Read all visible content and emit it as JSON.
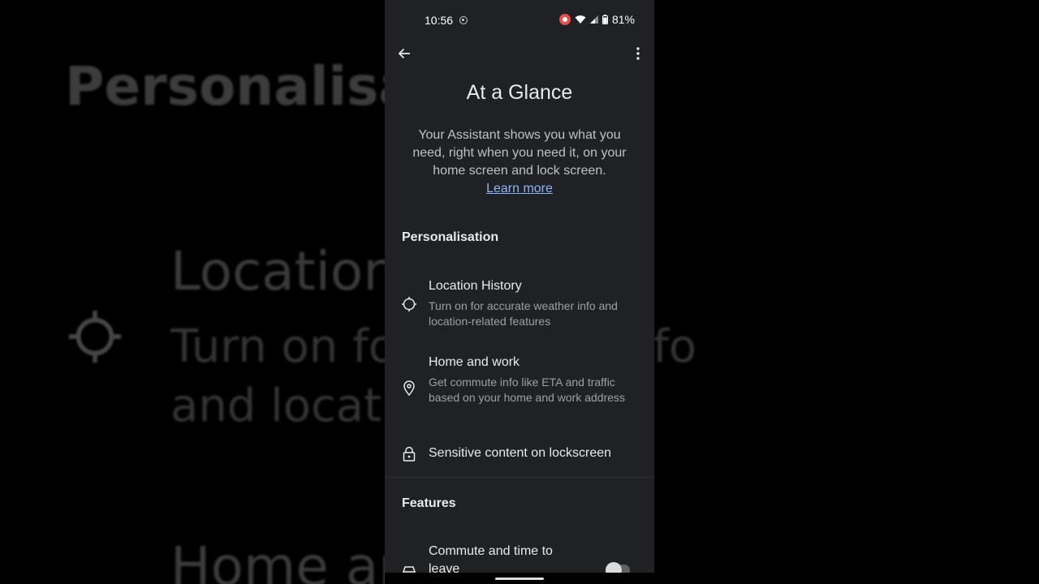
{
  "background": {
    "title": "Personalisat",
    "location_title": "Location",
    "location_desc_line1": "Turn on fo                         weather info",
    "location_desc_line2": "and locati                          eatures",
    "home_title": "Home an"
  },
  "status_bar": {
    "time": "10:56",
    "battery": "81%"
  },
  "header": {
    "title": "At a Glance",
    "description": "Your Assistant shows you what you need, right when you need it, on your home screen and lock screen.",
    "learn_more": "Learn more"
  },
  "sections": {
    "personalisation": "Personalisation",
    "features": "Features"
  },
  "items": {
    "location_history": {
      "title": "Location History",
      "subtitle": "Turn on for accurate weather info and location-related features",
      "icon": "location-target-icon"
    },
    "home_work": {
      "title": "Home and work",
      "subtitle": "Get commute info like ETA and traffic based on your home and work address",
      "icon": "map-pin-icon"
    },
    "sensitive_content": {
      "title": "Sensitive content on lockscreen",
      "icon": "lock-icon"
    },
    "commute": {
      "title_line1": "Commute and time to",
      "title_line2": "leave",
      "icon": "car-icon",
      "enabled": false
    }
  },
  "colors": {
    "surface": "#202124",
    "link": "#8ab4f8",
    "recording": "#e84d4d"
  }
}
